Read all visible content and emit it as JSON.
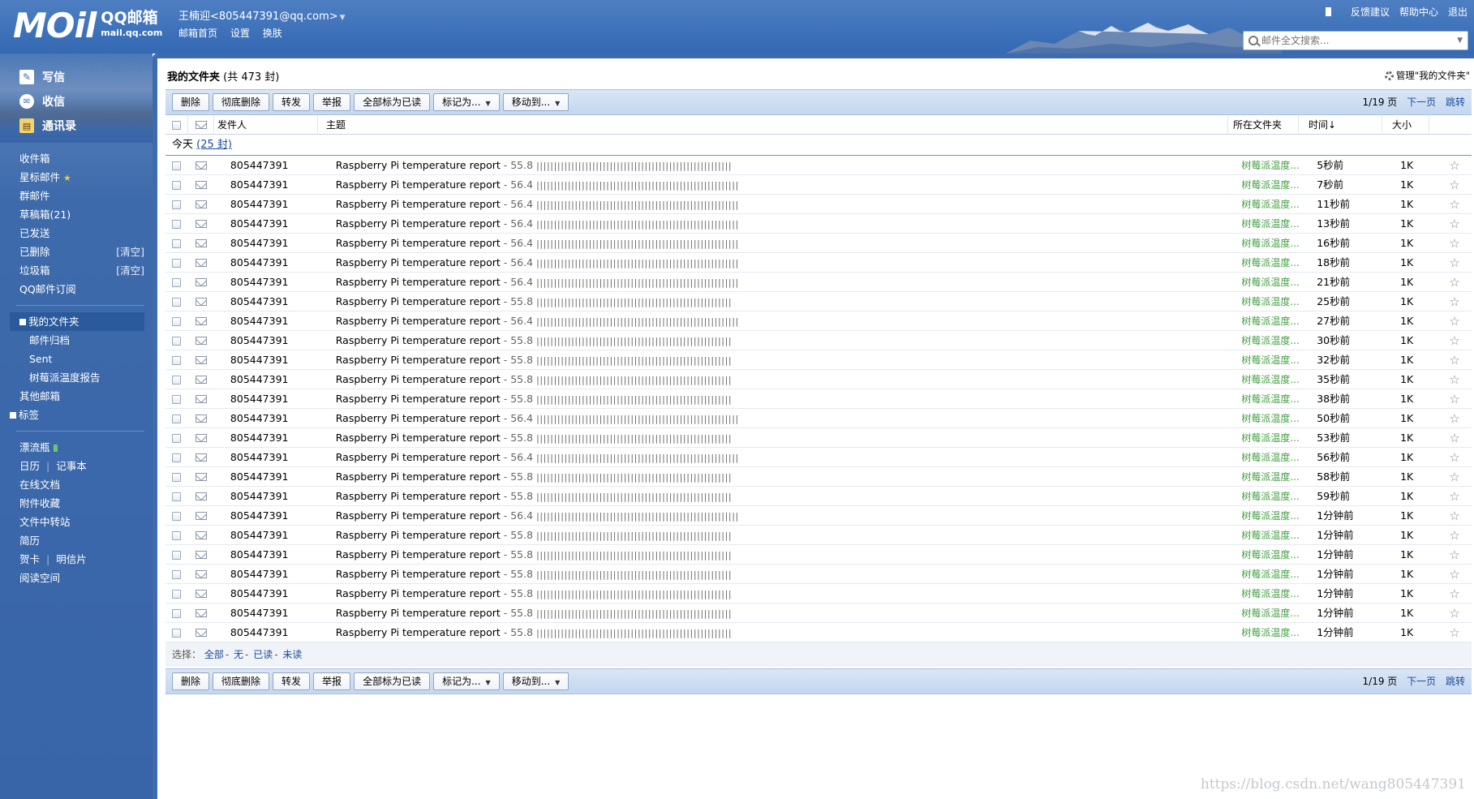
{
  "header": {
    "logo_text": "MOil",
    "logo_brand": "QQ邮箱",
    "logo_domain": "mail.qq.com",
    "user_name": "王楠迎<805447391@qq.com>",
    "links": [
      "邮箱首页",
      "设置",
      "换肤"
    ],
    "top_links": [
      "反馈建议",
      "帮助中心",
      "退出"
    ],
    "search_placeholder": "邮件全文搜索..."
  },
  "sidebar": {
    "main_actions": [
      {
        "label": "写信",
        "icon": "write-icon"
      },
      {
        "label": "收信",
        "icon": "inbox-icon"
      },
      {
        "label": "通讯录",
        "icon": "contacts-icon"
      }
    ],
    "folders": [
      {
        "label": "收件箱"
      },
      {
        "label": "星标邮件"
      },
      {
        "label": "群邮件"
      },
      {
        "label": "草稿箱(21)"
      },
      {
        "label": "已发送"
      },
      {
        "label": "已删除",
        "action": "[清空]"
      },
      {
        "label": "垃圾箱",
        "action": "[清空]"
      },
      {
        "label": "QQ邮件订阅"
      }
    ],
    "my_folders_label": "我的文件夹",
    "my_folders": [
      "邮件归档",
      "Sent",
      "树莓派温度报告"
    ],
    "other_mailbox": "其他邮箱",
    "tags_label": "标签",
    "apps": [
      "漂流瓶",
      "日历",
      "记事本",
      "在线文档",
      "附件收藏",
      "文件中转站",
      "简历",
      "贺卡",
      "明信片",
      "阅读空间"
    ]
  },
  "main": {
    "title": "我的文件夹",
    "count_text": "(共 473 封)",
    "manage_link": "管理\"我的文件夹\"",
    "toolbar": {
      "buttons": [
        "删除",
        "彻底删除",
        "转发",
        "举报",
        "全部标为已读"
      ],
      "dropdowns": [
        "标记为...",
        "移动到..."
      ],
      "page": "1/19 页",
      "next": "下一页",
      "jump": "跳转"
    },
    "columns": {
      "from": "发件人",
      "subject": "主题",
      "folder": "所在文件夹",
      "time": "时间↓",
      "size": "大小"
    },
    "group": {
      "label": "今天",
      "count": "(25 封)"
    },
    "rows": [
      {
        "from": "805447391",
        "subject": "Raspberry Pi temperature report",
        "value": "55.8",
        "bars": "||||||||||||||||||||||||||||||||||||||||||||||||||||||||",
        "folder": "树莓派温度...",
        "time": "5秒前",
        "size": "1K"
      },
      {
        "from": "805447391",
        "subject": "Raspberry Pi temperature report",
        "value": "56.4",
        "bars": "||||||||||||||||||||||||||||||||||||||||||||||||||||||||||",
        "folder": "树莓派温度...",
        "time": "7秒前",
        "size": "1K"
      },
      {
        "from": "805447391",
        "subject": "Raspberry Pi temperature report",
        "value": "56.4",
        "bars": "||||||||||||||||||||||||||||||||||||||||||||||||||||||||||",
        "folder": "树莓派温度...",
        "time": "11秒前",
        "size": "1K"
      },
      {
        "from": "805447391",
        "subject": "Raspberry Pi temperature report",
        "value": "56.4",
        "bars": "||||||||||||||||||||||||||||||||||||||||||||||||||||||||||",
        "folder": "树莓派温度...",
        "time": "13秒前",
        "size": "1K"
      },
      {
        "from": "805447391",
        "subject": "Raspberry Pi temperature report",
        "value": "56.4",
        "bars": "||||||||||||||||||||||||||||||||||||||||||||||||||||||||||",
        "folder": "树莓派温度...",
        "time": "16秒前",
        "size": "1K"
      },
      {
        "from": "805447391",
        "subject": "Raspberry Pi temperature report",
        "value": "56.4",
        "bars": "||||||||||||||||||||||||||||||||||||||||||||||||||||||||||",
        "folder": "树莓派温度...",
        "time": "18秒前",
        "size": "1K"
      },
      {
        "from": "805447391",
        "subject": "Raspberry Pi temperature report",
        "value": "56.4",
        "bars": "||||||||||||||||||||||||||||||||||||||||||||||||||||||||||",
        "folder": "树莓派温度...",
        "time": "21秒前",
        "size": "1K"
      },
      {
        "from": "805447391",
        "subject": "Raspberry Pi temperature report",
        "value": "55.8",
        "bars": "||||||||||||||||||||||||||||||||||||||||||||||||||||||||",
        "folder": "树莓派温度...",
        "time": "25秒前",
        "size": "1K"
      },
      {
        "from": "805447391",
        "subject": "Raspberry Pi temperature report",
        "value": "56.4",
        "bars": "||||||||||||||||||||||||||||||||||||||||||||||||||||||||||",
        "folder": "树莓派温度...",
        "time": "27秒前",
        "size": "1K"
      },
      {
        "from": "805447391",
        "subject": "Raspberry Pi temperature report",
        "value": "55.8",
        "bars": "||||||||||||||||||||||||||||||||||||||||||||||||||||||||",
        "folder": "树莓派温度...",
        "time": "30秒前",
        "size": "1K"
      },
      {
        "from": "805447391",
        "subject": "Raspberry Pi temperature report",
        "value": "55.8",
        "bars": "||||||||||||||||||||||||||||||||||||||||||||||||||||||||",
        "folder": "树莓派温度...",
        "time": "32秒前",
        "size": "1K"
      },
      {
        "from": "805447391",
        "subject": "Raspberry Pi temperature report",
        "value": "55.8",
        "bars": "||||||||||||||||||||||||||||||||||||||||||||||||||||||||",
        "folder": "树莓派温度...",
        "time": "35秒前",
        "size": "1K"
      },
      {
        "from": "805447391",
        "subject": "Raspberry Pi temperature report",
        "value": "55.8",
        "bars": "||||||||||||||||||||||||||||||||||||||||||||||||||||||||",
        "folder": "树莓派温度...",
        "time": "38秒前",
        "size": "1K"
      },
      {
        "from": "805447391",
        "subject": "Raspberry Pi temperature report",
        "value": "56.4",
        "bars": "||||||||||||||||||||||||||||||||||||||||||||||||||||||||||",
        "folder": "树莓派温度...",
        "time": "50秒前",
        "size": "1K"
      },
      {
        "from": "805447391",
        "subject": "Raspberry Pi temperature report",
        "value": "55.8",
        "bars": "||||||||||||||||||||||||||||||||||||||||||||||||||||||||",
        "folder": "树莓派温度...",
        "time": "53秒前",
        "size": "1K"
      },
      {
        "from": "805447391",
        "subject": "Raspberry Pi temperature report",
        "value": "56.4",
        "bars": "||||||||||||||||||||||||||||||||||||||||||||||||||||||||||",
        "folder": "树莓派温度...",
        "time": "56秒前",
        "size": "1K"
      },
      {
        "from": "805447391",
        "subject": "Raspberry Pi temperature report",
        "value": "55.8",
        "bars": "||||||||||||||||||||||||||||||||||||||||||||||||||||||||",
        "folder": "树莓派温度...",
        "time": "58秒前",
        "size": "1K"
      },
      {
        "from": "805447391",
        "subject": "Raspberry Pi temperature report",
        "value": "55.8",
        "bars": "||||||||||||||||||||||||||||||||||||||||||||||||||||||||",
        "folder": "树莓派温度...",
        "time": "59秒前",
        "size": "1K"
      },
      {
        "from": "805447391",
        "subject": "Raspberry Pi temperature report",
        "value": "56.4",
        "bars": "||||||||||||||||||||||||||||||||||||||||||||||||||||||||||",
        "folder": "树莓派温度...",
        "time": "1分钟前",
        "size": "1K"
      },
      {
        "from": "805447391",
        "subject": "Raspberry Pi temperature report",
        "value": "55.8",
        "bars": "||||||||||||||||||||||||||||||||||||||||||||||||||||||||",
        "folder": "树莓派温度...",
        "time": "1分钟前",
        "size": "1K"
      },
      {
        "from": "805447391",
        "subject": "Raspberry Pi temperature report",
        "value": "55.8",
        "bars": "||||||||||||||||||||||||||||||||||||||||||||||||||||||||",
        "folder": "树莓派温度...",
        "time": "1分钟前",
        "size": "1K"
      },
      {
        "from": "805447391",
        "subject": "Raspberry Pi temperature report",
        "value": "55.8",
        "bars": "||||||||||||||||||||||||||||||||||||||||||||||||||||||||",
        "folder": "树莓派温度...",
        "time": "1分钟前",
        "size": "1K"
      },
      {
        "from": "805447391",
        "subject": "Raspberry Pi temperature report",
        "value": "55.8",
        "bars": "||||||||||||||||||||||||||||||||||||||||||||||||||||||||",
        "folder": "树莓派温度...",
        "time": "1分钟前",
        "size": "1K"
      },
      {
        "from": "805447391",
        "subject": "Raspberry Pi temperature report",
        "value": "55.8",
        "bars": "||||||||||||||||||||||||||||||||||||||||||||||||||||||||",
        "folder": "树莓派温度...",
        "time": "1分钟前",
        "size": "1K"
      },
      {
        "from": "805447391",
        "subject": "Raspberry Pi temperature report",
        "value": "55.8",
        "bars": "||||||||||||||||||||||||||||||||||||||||||||||||||||||||",
        "folder": "树莓派温度...",
        "time": "1分钟前",
        "size": "1K"
      }
    ],
    "select": {
      "label": "选择：",
      "options": [
        "全部",
        "无",
        "已读",
        "未读"
      ]
    },
    "watermark": "https://blog.csdn.net/wang805447391"
  },
  "colors": {
    "header_blue": "#3a6fb8",
    "sidebar_blue": "#3865a8",
    "toolbar_bg": "#c4d7ef",
    "folder_green": "#45a045",
    "link_blue": "#1a4a9c"
  }
}
